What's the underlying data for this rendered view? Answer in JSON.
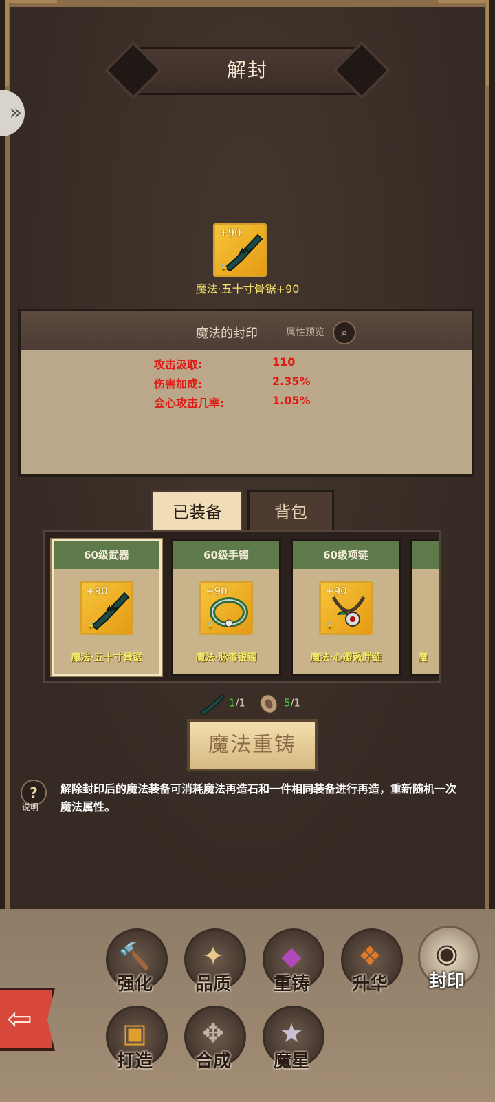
{
  "screen": {
    "title": "解封"
  },
  "selected_item": {
    "name": "魔法·五十寸骨锯+90",
    "enhance": "+90",
    "icon": "bone-saw-icon"
  },
  "seal_panel": {
    "title": "魔法的封印",
    "preview_label": "属性预览",
    "stats": [
      {
        "name": "攻击汲取:",
        "value": "110"
      },
      {
        "name": "伤害加成:",
        "value": "2.35%"
      },
      {
        "name": "会心攻击几率:",
        "value": "1.05%"
      }
    ]
  },
  "tabs": [
    {
      "label": "已装备",
      "active": true
    },
    {
      "label": "背包",
      "active": false
    }
  ],
  "equipment_cards": [
    {
      "category": "60级武器",
      "name": "魔法·五十寸骨锯",
      "enhance": "+90",
      "icon": "bone-saw-icon",
      "selected": true
    },
    {
      "category": "60级手镯",
      "name": "魔法·脉毒银镯",
      "enhance": "+90",
      "icon": "bracelet-icon",
      "selected": false
    },
    {
      "category": "60级项链",
      "name": "魔法·心瓣锹胖链",
      "enhance": "+90",
      "icon": "necklace-icon",
      "selected": false
    },
    {
      "category": "",
      "name": "魔",
      "enhance": "",
      "icon": "",
      "selected": false
    }
  ],
  "materials": [
    {
      "icon": "bone-saw-icon",
      "have": "1",
      "need": "/1"
    },
    {
      "icon": "reforge-stone-icon",
      "have": "5",
      "need": "/1"
    }
  ],
  "reforge_button": "魔法重铸",
  "help": {
    "label": "说明",
    "text": "解除封印后的魔法装备可消耗魔法再造石和一件相同装备进行再造，重新随机一次魔法属性。"
  },
  "nav": [
    {
      "label": "强化",
      "icon": "hammer-icon",
      "active": false
    },
    {
      "label": "品质",
      "icon": "star-badge-icon",
      "active": false
    },
    {
      "label": "重铸",
      "icon": "anvil-icon",
      "active": false
    },
    {
      "label": "升华",
      "icon": "flame-leaf-icon",
      "active": false
    },
    {
      "label": "封印",
      "icon": "seal-eye-icon",
      "active": true
    },
    {
      "label": "打造",
      "icon": "forge-icon",
      "active": false
    },
    {
      "label": "合成",
      "icon": "combine-icon",
      "active": false
    },
    {
      "label": "魔星",
      "icon": "magic-star-icon",
      "active": false
    }
  ],
  "colors": {
    "stat_red": "#e01a14",
    "item_gold": "#f3e06a",
    "card_header_green": "#5f7a4a",
    "material_ok_green": "#3fd03f"
  }
}
